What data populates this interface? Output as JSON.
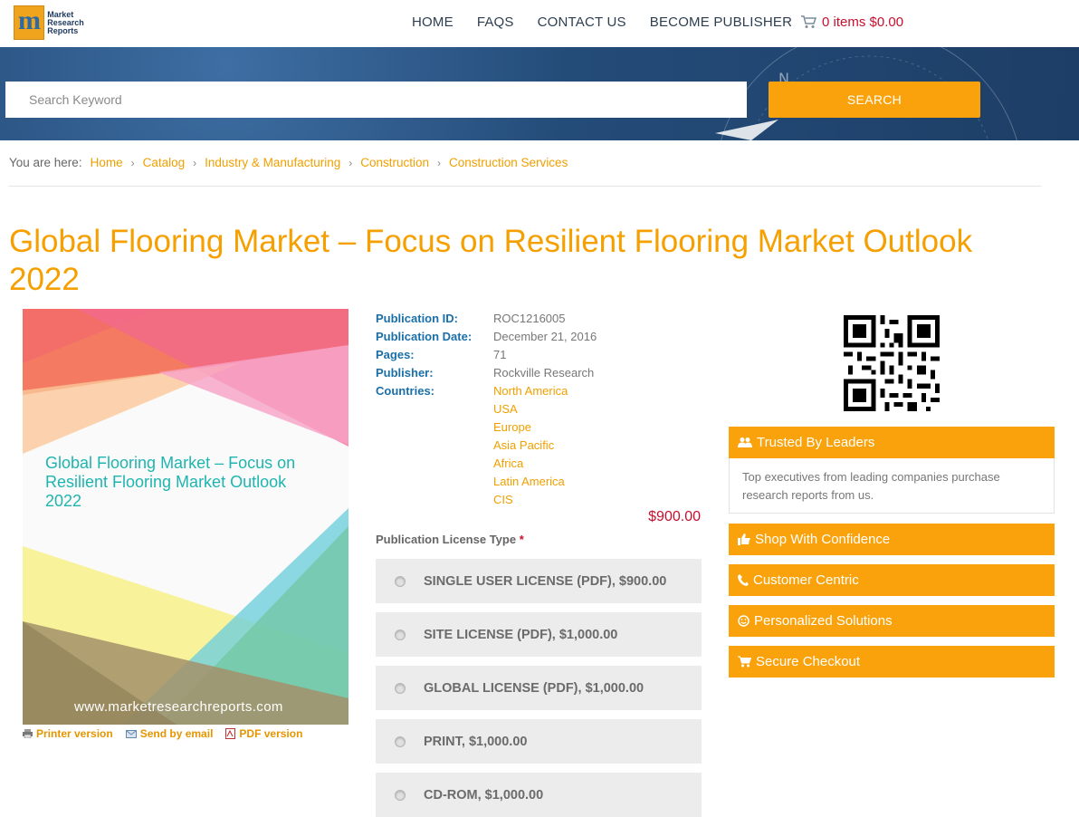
{
  "header": {
    "logo_text": [
      "Market",
      "Research",
      "Reports"
    ],
    "nav": [
      "HOME",
      "FAQS",
      "CONTACT US",
      "BECOME PUBLISHER"
    ],
    "cart_label": "0 items $0.00"
  },
  "search": {
    "placeholder": "Search Keyword",
    "button_label": "SEARCH"
  },
  "breadcrumb": {
    "prefix": "You are here:",
    "items": [
      "Home",
      "Catalog",
      "Industry & Manufacturing",
      "Construction",
      "Construction Services"
    ]
  },
  "product": {
    "title": "Global Flooring Market – Focus on Resilient Flooring Market Outlook 2022",
    "cover_title": "Global Flooring Market – Focus on Resilient Flooring Market Outlook 2022",
    "cover_url": "www.marketresearchreports.com",
    "details": {
      "publication_id_label": "Publication ID:",
      "publication_id": "ROC1216005",
      "publication_date_label": "Publication Date:",
      "publication_date": "December 21, 2016",
      "pages_label": "Pages:",
      "pages": "71",
      "publisher_label": "Publisher:",
      "publisher": "Rockville Research",
      "countries_label": "Countries:",
      "countries": [
        "North America",
        "USA",
        "Europe",
        "Asia Pacific",
        "Africa",
        "Latin America",
        "CIS"
      ]
    },
    "price": "$900.00",
    "license_label": "Publication License Type",
    "license_required_mark": "*",
    "licenses": [
      "SINGLE USER LICENSE (PDF), $900.00",
      "SITE LICENSE (PDF), $1,000.00",
      "GLOBAL LICENSE (PDF), $1,000.00",
      "PRINT, $1,000.00",
      "CD-ROM, $1,000.00"
    ],
    "tools": [
      "Printer version",
      "Send by email",
      "PDF version"
    ]
  },
  "sidebar": {
    "trusted_title": "Trusted By Leaders",
    "trusted_text": "Top executives from leading companies purchase research reports from us.",
    "features": [
      "Shop With Confidence",
      "Customer Centric",
      "Personalized Solutions",
      "Secure Checkout"
    ]
  },
  "colors": {
    "accent": "#f9a20b",
    "title": "#f5a000",
    "label_blue": "#1a6fa8",
    "price_red": "#c8102e",
    "banner": "#244c79"
  }
}
